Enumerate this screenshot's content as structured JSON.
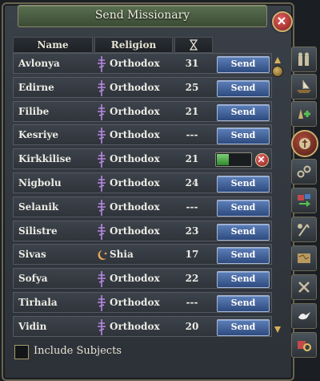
{
  "window": {
    "title": "Send Missionary"
  },
  "table": {
    "headers": {
      "name": "Name",
      "religion": "Religion"
    },
    "rows": [
      {
        "name": "Avlonya",
        "religion": "Orthodox",
        "days": "31",
        "action": "send",
        "send_label": "Send"
      },
      {
        "name": "Edirne",
        "religion": "Orthodox",
        "days": "25",
        "action": "send",
        "send_label": "Send"
      },
      {
        "name": "Filibe",
        "religion": "Orthodox",
        "days": "21",
        "action": "send",
        "send_label": "Send"
      },
      {
        "name": "Kesriye",
        "religion": "Orthodox",
        "days": "---",
        "action": "send",
        "send_label": "Send"
      },
      {
        "name": "Kirkkilise",
        "religion": "Orthodox",
        "days": "21",
        "action": "progress",
        "progress": 0.35
      },
      {
        "name": "Nigbolu",
        "religion": "Orthodox",
        "days": "24",
        "action": "send",
        "send_label": "Send"
      },
      {
        "name": "Selanik",
        "religion": "Orthodox",
        "days": "---",
        "action": "send",
        "send_label": "Send"
      },
      {
        "name": "Silistre",
        "religion": "Orthodox",
        "days": "23",
        "action": "send",
        "send_label": "Send"
      },
      {
        "name": "Sivas",
        "religion": "Shia",
        "days": "17",
        "action": "send",
        "send_label": "Send"
      },
      {
        "name": "Sofya",
        "religion": "Orthodox",
        "days": "22",
        "action": "send",
        "send_label": "Send"
      },
      {
        "name": "Tirhala",
        "religion": "Orthodox",
        "days": "---",
        "action": "send",
        "send_label": "Send"
      },
      {
        "name": "Vidin",
        "religion": "Orthodox",
        "days": "20",
        "action": "send",
        "send_label": "Send"
      }
    ]
  },
  "footer": {
    "include_subjects_label": "Include Subjects",
    "include_subjects_checked": false
  },
  "icons": {
    "header_time": "hourglass-icon",
    "orthodox": "orthodox-cross-icon",
    "shia": "crescent-icon",
    "side_tabs": [
      "army-icon",
      "fleet-icon",
      "colonize-icon",
      "missionary-icon",
      "chain-icon",
      "convert-icon",
      "military-access-icon",
      "map-icon",
      "alliance-icon",
      "dove-icon",
      "royal-marriage-icon"
    ]
  },
  "colors": {
    "title_bar": "#4a5e44",
    "send_button": "#3e5f98",
    "progress_fill": "#3fa13a",
    "orthodox_icon": "#b987e0",
    "shia_icon": "#e7a85a"
  }
}
